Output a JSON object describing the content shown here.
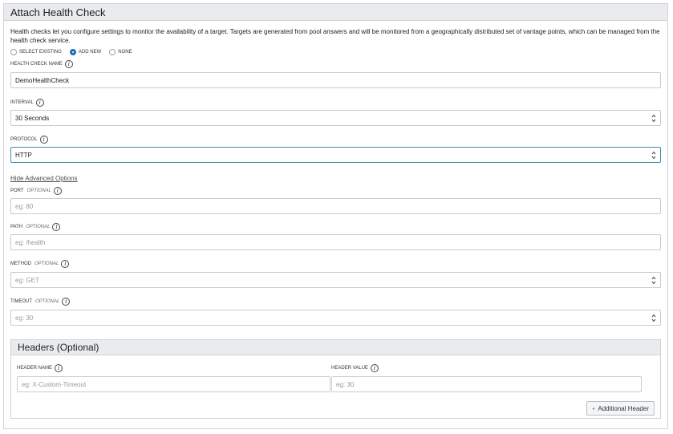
{
  "panel": {
    "title": "Attach Health Check",
    "description": "Health checks let you configure settings to monitor the availability of a target. Targets are generated from pool answers and will be monitored from a geographically distributed set of vantage points, which can be managed from the health check service."
  },
  "mode": {
    "options": [
      "SELECT EXISTING",
      "ADD NEW",
      "NONE"
    ],
    "selected": "ADD NEW"
  },
  "fields": {
    "name": {
      "label": "HEALTH CHECK NAME",
      "value": "DemoHealthCheck"
    },
    "interval": {
      "label": "INTERVAL",
      "value": "30 Seconds"
    },
    "protocol": {
      "label": "PROTOCOL",
      "value": "HTTP"
    },
    "port": {
      "label": "PORT",
      "optional": "OPTIONAL",
      "placeholder": "eg: 80"
    },
    "path": {
      "label": "PATH",
      "optional": "OPTIONAL",
      "placeholder": "eg: /health"
    },
    "method": {
      "label": "METHOD",
      "optional": "OPTIONAL",
      "placeholder": "eg: GET"
    },
    "timeout": {
      "label": "TIMEOUT",
      "optional": "OPTIONAL",
      "placeholder": "eg: 30"
    }
  },
  "advanced_link": "Hide Advanced Options",
  "headers": {
    "title": "Headers (Optional)",
    "name_label": "HEADER NAME",
    "name_placeholder": "eg: X-Custom-Timeout",
    "value_label": "HEADER VALUE",
    "value_placeholder": "eg: 30",
    "add_button": "Additional Header",
    "add_icon": "+"
  },
  "icons": {
    "info": "i"
  },
  "colors": {
    "accent": "#1e6fb5",
    "focus_border": "#3d8fb6",
    "header_bg": "#e9ebee"
  }
}
